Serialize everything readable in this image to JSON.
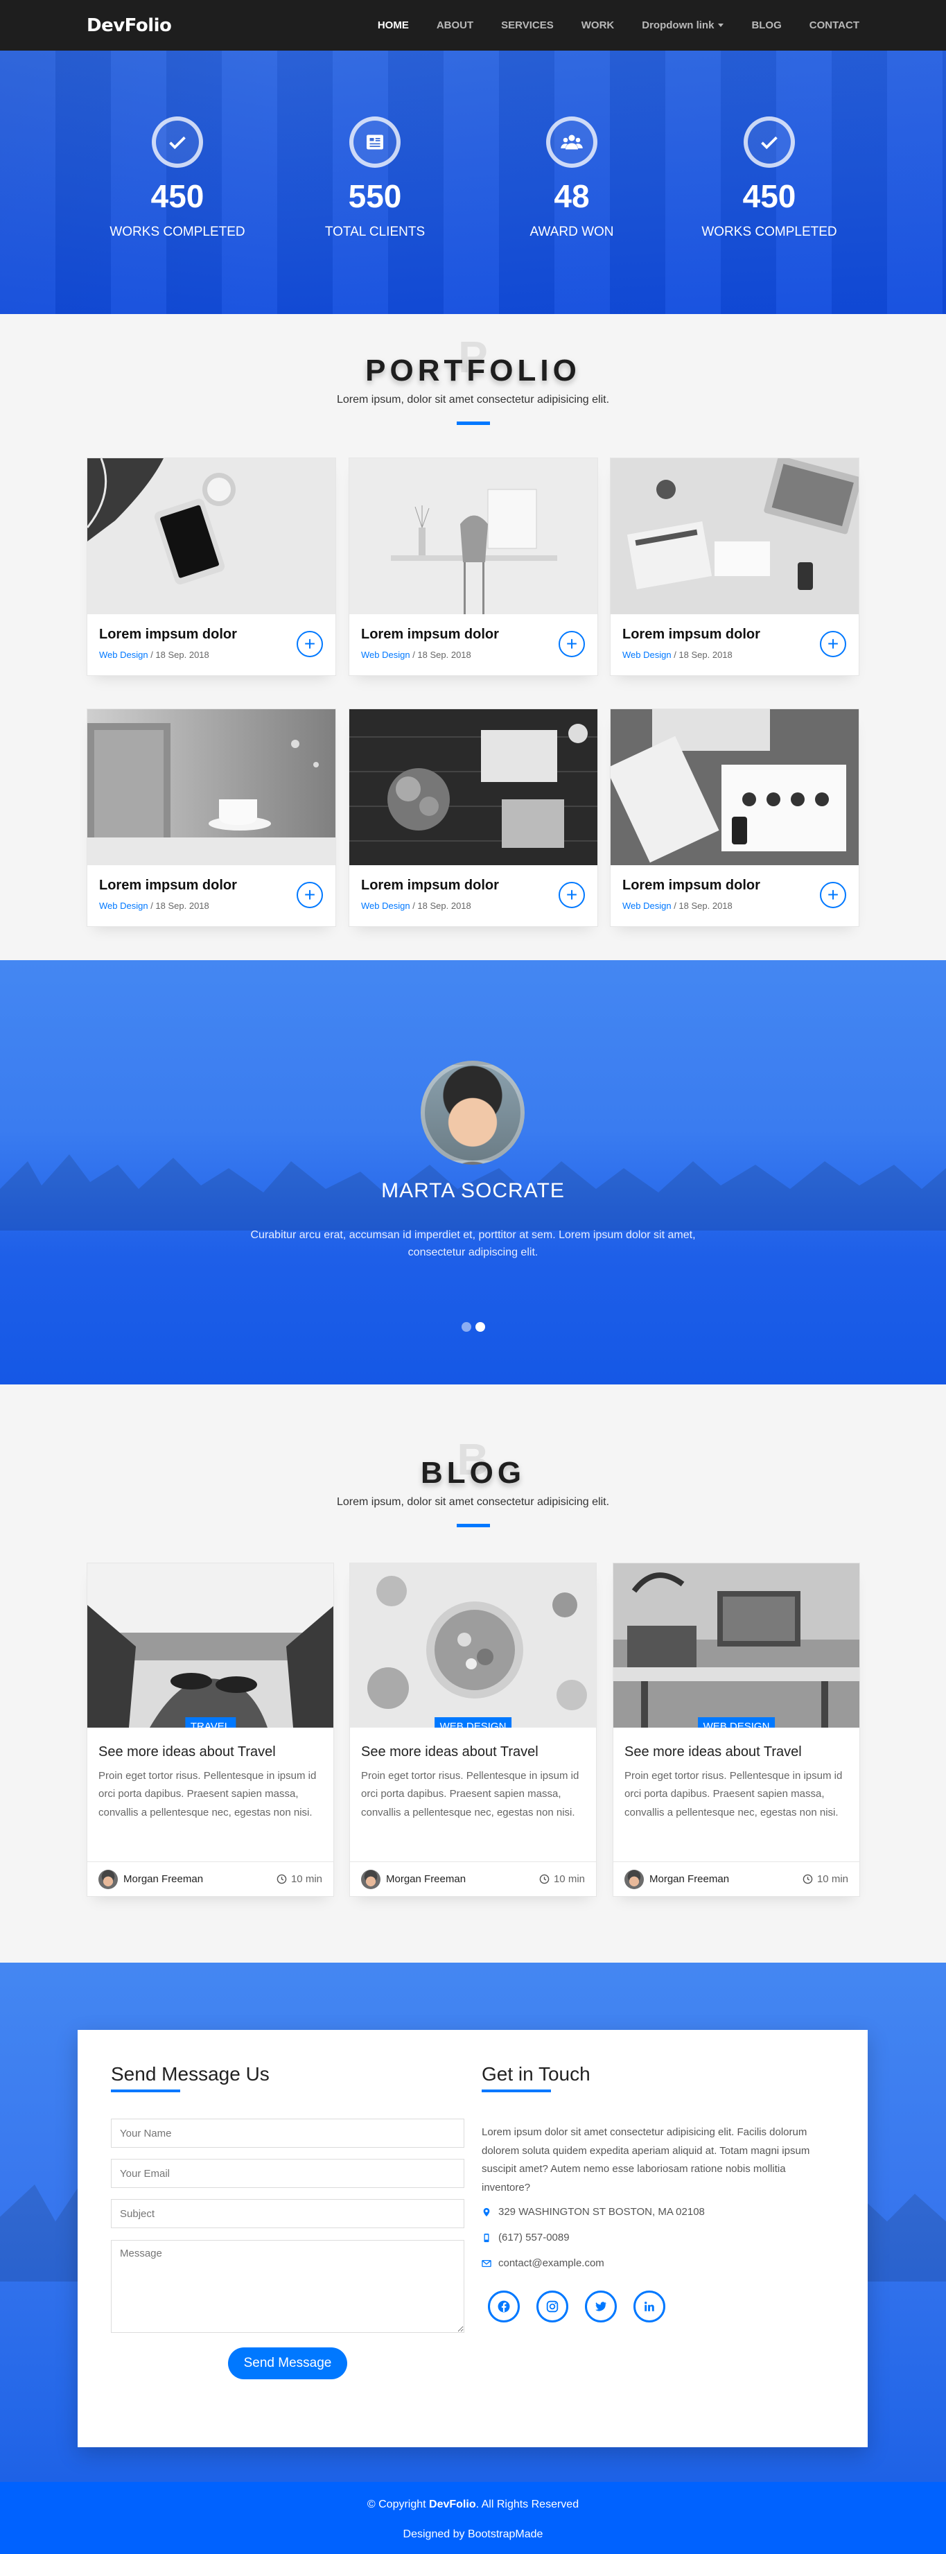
{
  "nav": {
    "brand": "DevFolio",
    "items": [
      {
        "label": "HOME",
        "active": true
      },
      {
        "label": "ABOUT"
      },
      {
        "label": "SERVICES"
      },
      {
        "label": "WORK"
      },
      {
        "label": "Dropdown link",
        "dropdown": true
      },
      {
        "label": "BLOG"
      },
      {
        "label": "CONTACT"
      }
    ]
  },
  "counters": [
    {
      "icon": "check-icon",
      "value": "450",
      "label": "WORKS COMPLETED"
    },
    {
      "icon": "newspaper-icon",
      "value": "550",
      "label": "TOTAL CLIENTS"
    },
    {
      "icon": "people-icon",
      "value": "48",
      "label": "AWARD WON"
    },
    {
      "icon": "check-icon",
      "value": "450",
      "label": "WORKS COMPLETED"
    }
  ],
  "portfolio": {
    "ghost": "P",
    "title": "PORTFOLIO",
    "subtitle": "Lorem ipsum, dolor sit amet consectetur adipisicing elit.",
    "items": [
      {
        "title": "Lorem impsum dolor",
        "category": "Web Design",
        "date": " / 18 Sep. 2018"
      },
      {
        "title": "Lorem impsum dolor",
        "category": "Web Design",
        "date": " / 18 Sep. 2018"
      },
      {
        "title": "Lorem impsum dolor",
        "category": "Web Design",
        "date": " / 18 Sep. 2018"
      },
      {
        "title": "Lorem impsum dolor",
        "category": "Web Design",
        "date": " / 18 Sep. 2018"
      },
      {
        "title": "Lorem impsum dolor",
        "category": "Web Design",
        "date": " / 18 Sep. 2018"
      },
      {
        "title": "Lorem impsum dolor",
        "category": "Web Design",
        "date": " / 18 Sep. 2018"
      }
    ]
  },
  "testimonial": {
    "name": "MARTA SOCRATE",
    "text": "Curabitur arcu erat, accumsan id imperdiet et, porttitor at sem. Lorem ipsum dolor sit amet, consectetur adipiscing elit."
  },
  "blog": {
    "ghost": "B",
    "title": "BLOG",
    "subtitle": "Lorem ipsum, dolor sit amet consectetur adipisicing elit.",
    "posts": [
      {
        "badge": "TRAVEL",
        "title": "See more ideas about Travel",
        "text": "Proin eget tortor risus. Pellentesque in ipsum id orci porta dapibus. Praesent sapien massa, convallis a pellentesque nec, egestas non nisi.",
        "author": "Morgan Freeman",
        "time": "10 min"
      },
      {
        "badge": "WEB DESIGN",
        "title": "See more ideas about Travel",
        "text": "Proin eget tortor risus. Pellentesque in ipsum id orci porta dapibus. Praesent sapien massa, convallis a pellentesque nec, egestas non nisi.",
        "author": "Morgan Freeman",
        "time": "10 min"
      },
      {
        "badge": "WEB DESIGN",
        "title": "See more ideas about Travel",
        "text": "Proin eget tortor risus. Pellentesque in ipsum id orci porta dapibus. Praesent sapien massa, convallis a pellentesque nec, egestas non nisi.",
        "author": "Morgan Freeman",
        "time": "10 min"
      }
    ]
  },
  "contact": {
    "form_title": "Send Message Us",
    "name_placeholder": "Your Name",
    "email_placeholder": "Your Email",
    "subject_placeholder": "Subject",
    "message_placeholder": "Message",
    "send_label": "Send Message",
    "touch_title": "Get in Touch",
    "touch_text": "Lorem ipsum dolor sit amet consectetur adipisicing elit. Facilis dolorum dolorem soluta quidem expedita aperiam aliquid at. Totam magni ipsum suscipit amet? Autem nemo esse laboriosam ratione nobis mollitia inventore?",
    "address": "329 WASHINGTON ST BOSTON, MA 02108",
    "phone": "(617) 557-0089",
    "email": "contact@example.com",
    "socials": [
      "facebook-icon",
      "instagram-icon",
      "twitter-icon",
      "linkedin-icon"
    ]
  },
  "footer": {
    "copy_prefix": "© Copyright ",
    "copy_brand": "DevFolio",
    "copy_suffix": ". All Rights Reserved",
    "credit": "Designed by BootstrapMade"
  },
  "colors": {
    "accent": "#0078ff",
    "nav_bg": "#1e1e1e",
    "footer_bg": "#0062ff"
  }
}
